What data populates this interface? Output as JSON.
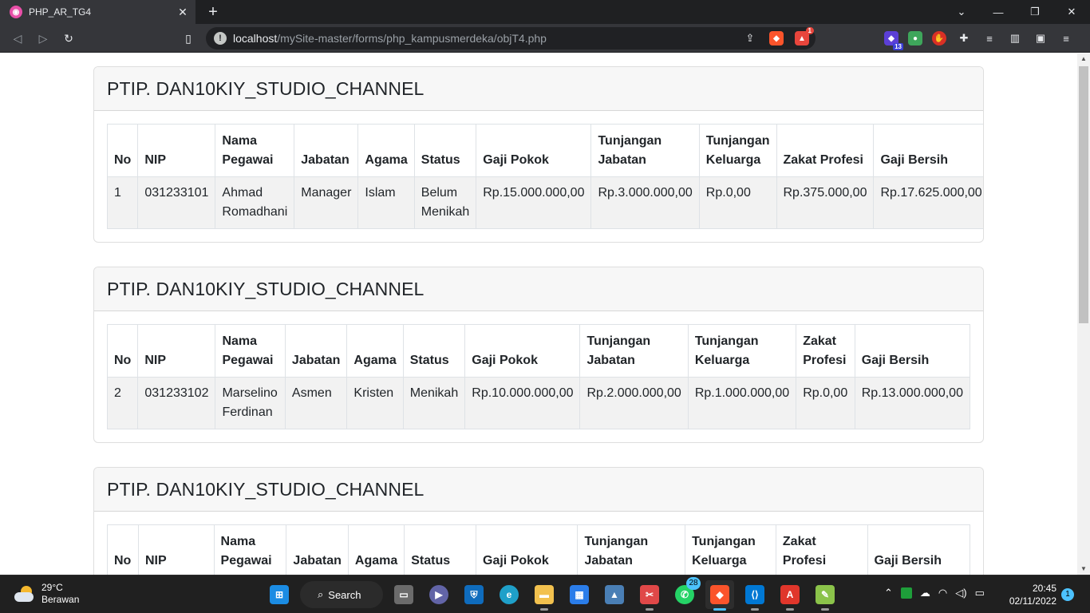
{
  "browser": {
    "tab_title": "PHP_AR_TG4",
    "tab_favicon": "php-logo-icon",
    "url_host": "localhost",
    "url_path": "/mySite-master/forms/php_kampusmerdeka/objT4.php",
    "brave_badge_count": "1",
    "extension_badge": "13"
  },
  "page": {
    "columns": [
      "No",
      "NIP",
      "Nama Pegawai",
      "Jabatan",
      "Agama",
      "Status",
      "Gaji Pokok",
      "Tunjangan Jabatan",
      "Tunjangan Keluarga",
      "Zakat Profesi",
      "Gaji Bersih"
    ],
    "cards": [
      {
        "title": "PTIP. DAN10KIY_STUDIO_CHANNEL",
        "row": [
          "1",
          "031233101",
          "Ahmad Romadhani",
          "Manager",
          "Islam",
          "Belum Menikah",
          "Rp.15.000.000,00",
          "Rp.3.000.000,00",
          "Rp.0,00",
          "Rp.375.000,00",
          "Rp.17.625.000,00"
        ]
      },
      {
        "title": "PTIP. DAN10KIY_STUDIO_CHANNEL",
        "row": [
          "2",
          "031233102",
          "Marselino Ferdinan",
          "Asmen",
          "Kristen",
          "Menikah",
          "Rp.10.000.000,00",
          "Rp.2.000.000,00",
          "Rp.1.000.000,00",
          "Rp.0,00",
          "Rp.13.000.000,00"
        ]
      },
      {
        "title": "PTIP. DAN10KIY_STUDIO_CHANNEL",
        "row": []
      }
    ]
  },
  "taskbar": {
    "weather_temp": "29°C",
    "weather_desc": "Berawan",
    "search_label": "Search",
    "whatsapp_badge": "28",
    "time": "20:45",
    "date": "02/11/2022",
    "notification_count": "1"
  },
  "colors": {
    "chrome_bg": "#35363a",
    "tabbar_bg": "#1f2022",
    "card_header_bg": "#f7f7f7",
    "row_bg": "#f2f2f2",
    "taskbar_bg": "#202020",
    "accent": "#4cc2ff"
  }
}
